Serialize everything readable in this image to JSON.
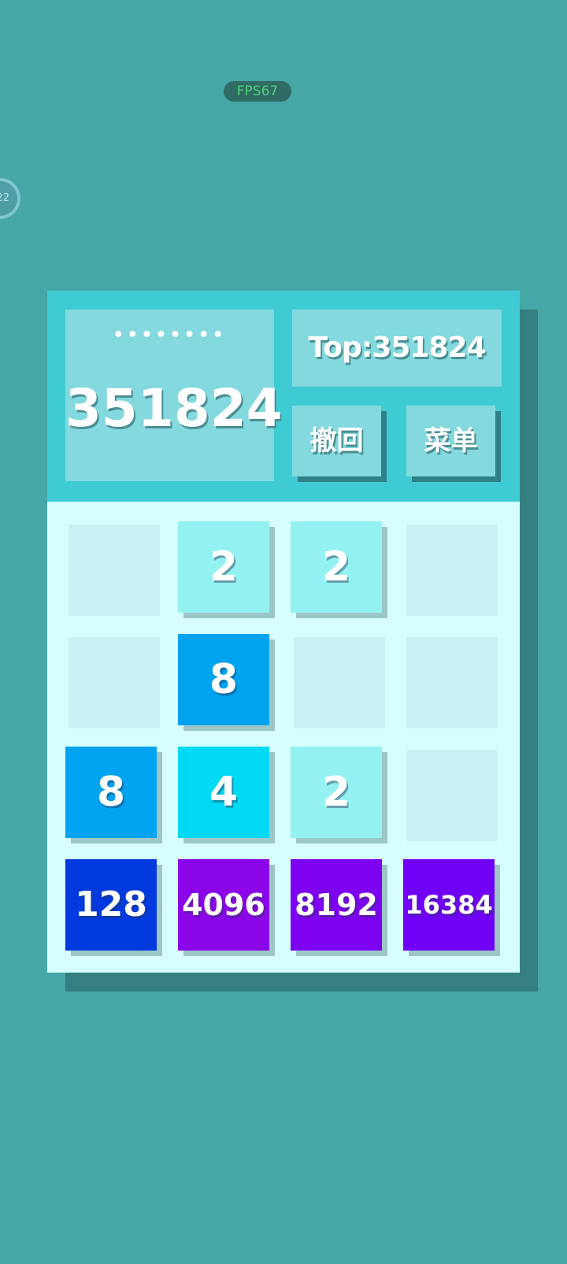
{
  "fps": "FPS67",
  "float_ball_text": "22",
  "header": {
    "dots": "••••••••",
    "score": "351824",
    "top": "Top:351824",
    "undo_label": "撤回",
    "menu_label": "菜单"
  },
  "colors": {
    "background": "#46a7a7",
    "header": "#3fcbd3",
    "panel": "#83d9dd",
    "grid": "#d6fefe",
    "empty_cell": "#c7f2f1",
    "tile_2": "#94f1f1",
    "tile_4": "#00d9f3",
    "tile_8": "#00a3ef",
    "tile_128": "#0039de",
    "tile_4096": "#8a05e8",
    "tile_8192": "#7d02f0",
    "tile_16384": "#7000f6"
  },
  "grid": [
    [
      "",
      "2",
      "2",
      ""
    ],
    [
      "",
      "8",
      "",
      ""
    ],
    [
      "8",
      "4",
      "2",
      ""
    ],
    [
      "128",
      "4096",
      "8192",
      "16384"
    ]
  ]
}
